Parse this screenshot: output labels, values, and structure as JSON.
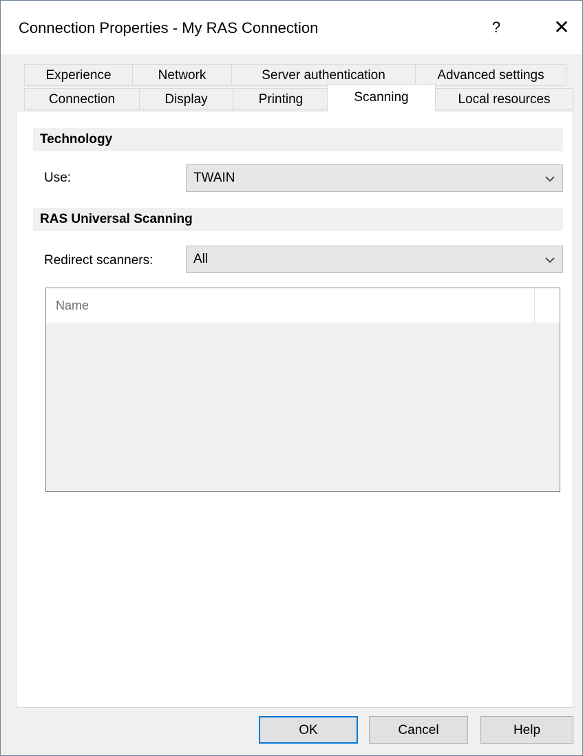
{
  "window": {
    "title": "Connection Properties - My RAS Connection",
    "help_glyph": "?",
    "close_glyph": "✕"
  },
  "tabs": {
    "row_back": [
      {
        "label": "Experience"
      },
      {
        "label": "Network"
      },
      {
        "label": "Server authentication"
      },
      {
        "label": "Advanced settings"
      }
    ],
    "row_front": [
      {
        "label": "Connection"
      },
      {
        "label": "Display"
      },
      {
        "label": "Printing"
      },
      {
        "label": "Scanning",
        "active": true
      },
      {
        "label": "Local resources"
      }
    ]
  },
  "technology": {
    "header": "Technology",
    "use_label": "Use:",
    "use_value": "TWAIN"
  },
  "universal_scanning": {
    "header": "RAS Universal Scanning",
    "redirect_label": "Redirect scanners:",
    "redirect_value": "All",
    "list": {
      "columns": [
        "Name"
      ],
      "rows": []
    }
  },
  "buttons": {
    "ok": "OK",
    "cancel": "Cancel",
    "help": "Help"
  },
  "colors": {
    "accent": "#0078d7",
    "panel": "#ffffff",
    "chrome": "#f0f0f0"
  }
}
